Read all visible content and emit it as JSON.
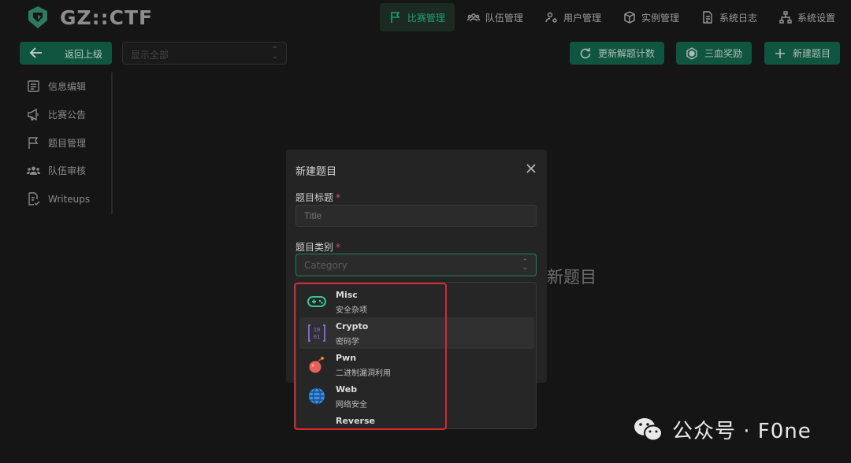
{
  "app": {
    "logo_text": "GZ::CTF"
  },
  "nav": [
    {
      "label": "比赛管理",
      "icon": "flag-icon",
      "active": true
    },
    {
      "label": "队伍管理",
      "icon": "users-icon"
    },
    {
      "label": "用户管理",
      "icon": "user-gear-icon"
    },
    {
      "label": "实例管理",
      "icon": "box-icon"
    },
    {
      "label": "系统日志",
      "icon": "file-text-icon"
    },
    {
      "label": "系统设置",
      "icon": "sitemap-icon"
    }
  ],
  "toolbar": {
    "back_label": "返回上级",
    "filter_placeholder": "显示全部",
    "update_count_label": "更新解题计数",
    "blood_bonus_label": "三血奖励",
    "new_challenge_label": "新建题目"
  },
  "sidebar": {
    "items": [
      {
        "label": "信息编辑",
        "icon": "edit-icon"
      },
      {
        "label": "比赛公告",
        "icon": "megaphone-icon"
      },
      {
        "label": "题目管理",
        "icon": "flag-icon",
        "active": true
      },
      {
        "label": "队伍审核",
        "icon": "users-icon"
      },
      {
        "label": "Writeups",
        "icon": "file-check-icon"
      }
    ]
  },
  "background_text": "新题目",
  "modal": {
    "title": "新建题目",
    "title_field": {
      "label": "题目标题",
      "required": "*",
      "placeholder": "Title"
    },
    "category_field": {
      "label": "题目类别",
      "required": "*",
      "placeholder": "Category"
    }
  },
  "dropdown": {
    "options": [
      {
        "name": "Misc",
        "desc": "安全杂项",
        "icon": "gamepad-icon",
        "color": "#38c78f"
      },
      {
        "name": "Crypto",
        "desc": "密码学",
        "icon": "binary-icon",
        "color": "#8a6de0"
      },
      {
        "name": "Pwn",
        "desc": "二进制漏洞利用",
        "icon": "bomb-icon",
        "color": "#e8605a"
      },
      {
        "name": "Web",
        "desc": "网络安全",
        "icon": "globe-icon",
        "color": "#3a8ee6"
      },
      {
        "name": "Reverse",
        "desc": "",
        "icon": "reverse-icon",
        "color": "#e0b020"
      }
    ]
  },
  "watermark": {
    "text": "公众号 · F0ne",
    "icon": "wechat-icon"
  },
  "colors": {
    "accent": "#1f9e73",
    "button_bg": "#10553f",
    "highlight": "#d42a2f"
  }
}
